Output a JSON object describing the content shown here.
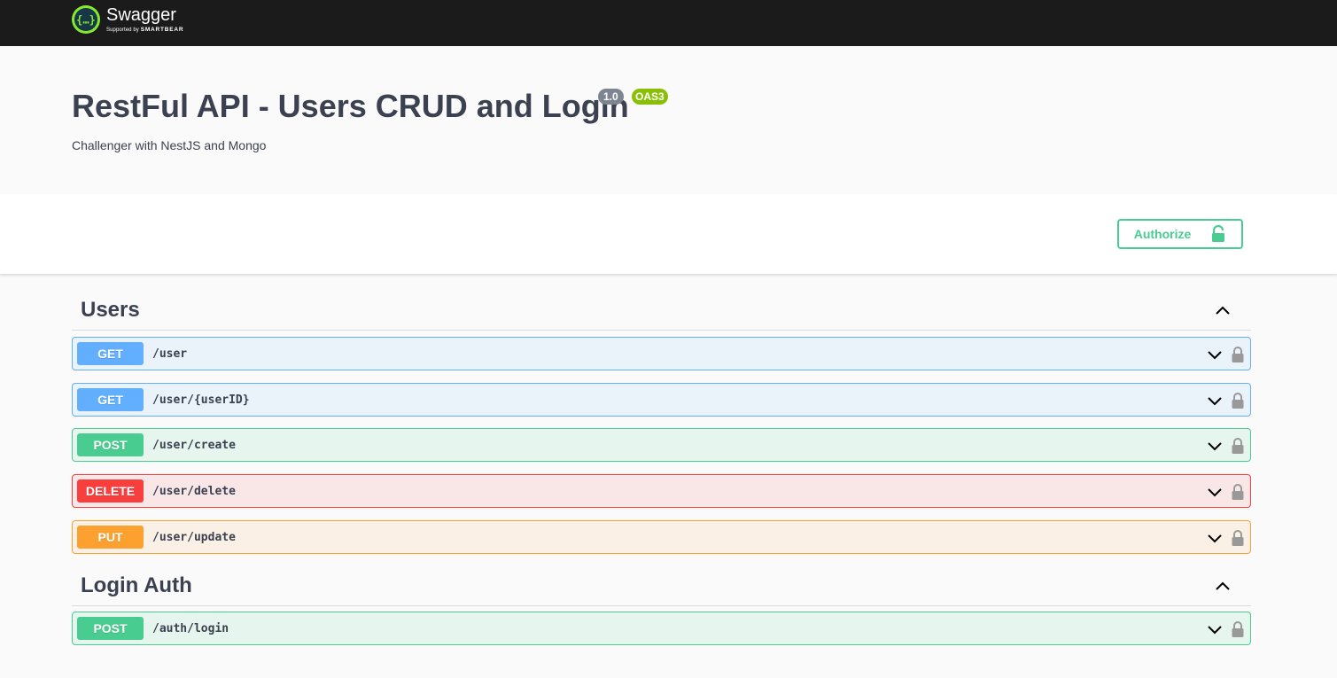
{
  "topbar": {
    "brand_name": "Swagger",
    "brand_sub_prefix": "Supported by",
    "brand_sub_company": "SMARTBEAR",
    "logo_icon": "swagger-logo-icon"
  },
  "info": {
    "title": "RestFul API - Users CRUD and Login",
    "version": "1.0",
    "oas_badge": "OAS3",
    "description": "Challenger with NestJS and Mongo"
  },
  "scheme": {
    "authorize_label": "Authorize",
    "authorize_icon": "unlock-icon"
  },
  "tags": [
    {
      "name": "Users",
      "operations": [
        {
          "method": "GET",
          "path": "/user"
        },
        {
          "method": "GET",
          "path": "/user/{userID}"
        },
        {
          "method": "POST",
          "path": "/user/create"
        },
        {
          "method": "DELETE",
          "path": "/user/delete"
        },
        {
          "method": "PUT",
          "path": "/user/update"
        }
      ]
    },
    {
      "name": "Login Auth",
      "operations": [
        {
          "method": "POST",
          "path": "/auth/login"
        }
      ]
    }
  ],
  "colors": {
    "get": "#61affe",
    "post": "#49cc90",
    "delete": "#f93e3e",
    "put": "#fca130",
    "topbar": "#1b1b1b",
    "logo_green": "#85ea2d"
  }
}
